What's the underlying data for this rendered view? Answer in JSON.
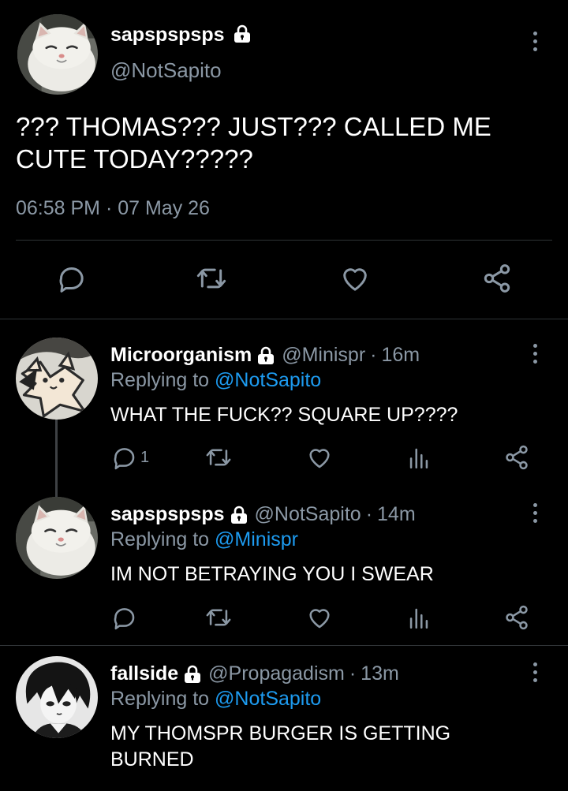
{
  "main_tweet": {
    "name": "sapspspsps",
    "handle": "@NotSapito",
    "text": "??? THOMAS??? JUST??? CALLED ME CUTE TODAY?????",
    "timestamp": "06:58 PM · 07 May 26"
  },
  "replies": [
    {
      "name": "Microorganism",
      "handle": "@Minispr",
      "time": "16m",
      "replying_prefix": "Replying to ",
      "replying_to": "@NotSapito",
      "text": "WHAT THE FUCK?? SQUARE UP????",
      "reply_count": "1"
    },
    {
      "name": "sapspspsps",
      "handle": "@NotSapito",
      "time": "14m",
      "replying_prefix": "Replying to ",
      "replying_to": "@Minispr",
      "text": "IM NOT BETRAYING YOU I SWEAR"
    },
    {
      "name": "fallside",
      "handle": "@Propagadism",
      "time": "13m",
      "replying_prefix": "Replying to ",
      "replying_to": "@NotSapito",
      "text": "MY THOMSPR BURGER IS GETTING BURNED"
    }
  ],
  "separator": "·",
  "colors": {
    "background": "#000000",
    "secondary_text": "#8b98a5",
    "link": "#1d9bf0",
    "divider": "#2f3336"
  },
  "icons": [
    "lock-icon",
    "more-options-icon",
    "reply-icon",
    "retweet-icon",
    "like-icon",
    "share-icon",
    "analytics-icon"
  ]
}
